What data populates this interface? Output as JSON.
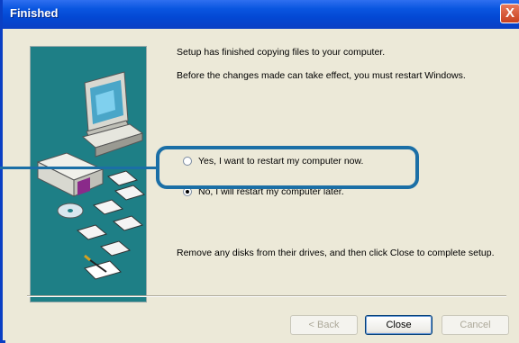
{
  "window": {
    "title": "Finished",
    "close_glyph": "X"
  },
  "messages": {
    "line1": "Setup has finished copying files to your computer.",
    "line2": "Before the changes made can take effect, you must restart Windows.",
    "line3": "Remove any disks from their drives, and then click Close to complete setup."
  },
  "options": {
    "restart_now": "Yes, I want to restart my computer now.",
    "restart_later": "No, I will restart my computer later.",
    "selected": "restart_later"
  },
  "buttons": {
    "back": "< Back",
    "close": "Close",
    "cancel": "Cancel"
  },
  "colors": {
    "panel": "#1e7f86",
    "highlight": "#1b6fa6",
    "titlebar": "#0a56e0"
  },
  "icons": [
    "computer-icon",
    "cd-icon",
    "floppy-disk-icon",
    "setup-box-icon",
    "pen-paper-icon"
  ]
}
